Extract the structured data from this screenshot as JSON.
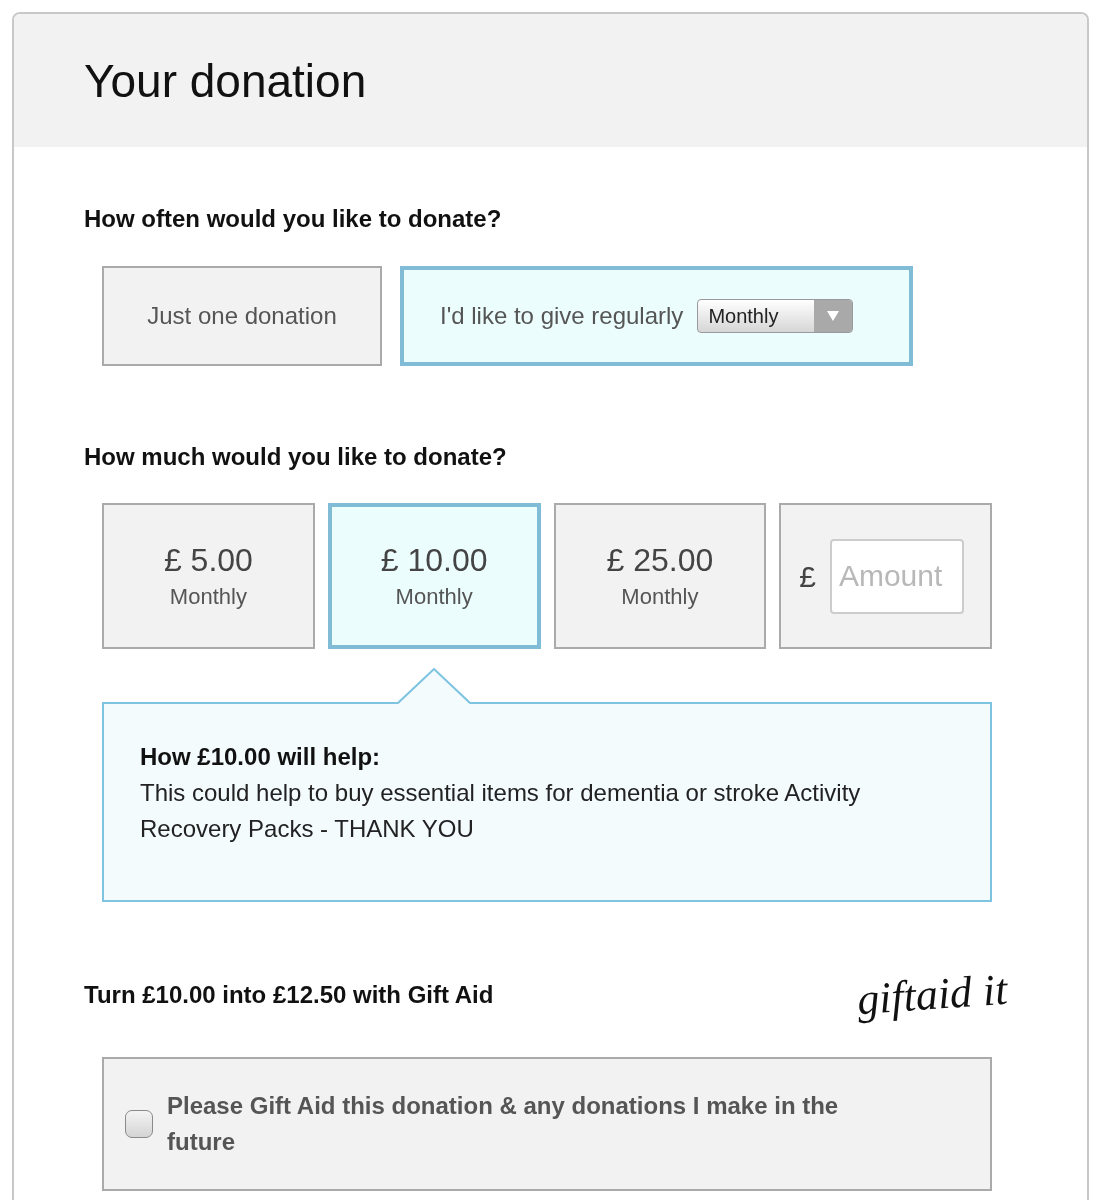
{
  "header": {
    "title": "Your donation"
  },
  "frequency": {
    "question": "How often would you like to donate?",
    "options": [
      {
        "kind": "plain",
        "label": "Just one donation",
        "selected": false
      },
      {
        "kind": "dropdown",
        "label": "I'd like to give regularly",
        "dropdown_value": "Monthly",
        "selected": true
      }
    ]
  },
  "amount": {
    "question": "How much would you like to donate?",
    "options": [
      {
        "kind": "preset",
        "value": "£ 5.00",
        "period": "Monthly",
        "selected": false
      },
      {
        "kind": "preset",
        "value": "£ 10.00",
        "period": "Monthly",
        "selected": true
      },
      {
        "kind": "preset",
        "value": "£ 25.00",
        "period": "Monthly",
        "selected": false
      },
      {
        "kind": "custom",
        "currency": "£",
        "placeholder": "Amount",
        "selected": false
      }
    ]
  },
  "help_panel": {
    "title": "How £10.00 will help:",
    "text": "This could help to buy essential items for dementia or stroke Activity Recovery Packs - THANK YOU"
  },
  "gift_aid": {
    "heading": "Turn £10.00 into £12.50 with Gift Aid",
    "logo": "giftaid it",
    "checkbox": {
      "label": "Please Gift Aid this donation & any donations I make in the future",
      "checked": false
    }
  }
}
